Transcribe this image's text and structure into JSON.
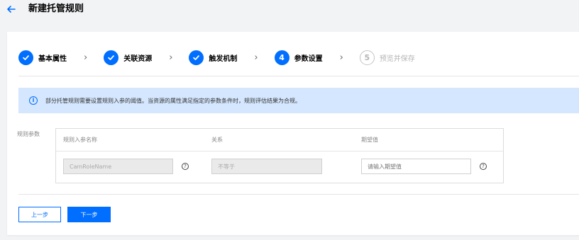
{
  "header": {
    "back_icon": "arrow-left-icon",
    "title": "新建托管规则"
  },
  "steps": [
    {
      "label": "基本属性",
      "state": "done",
      "icon": "check-icon"
    },
    {
      "label": "关联资源",
      "state": "done",
      "icon": "check-icon"
    },
    {
      "label": "触发机制",
      "state": "done",
      "icon": "check-icon"
    },
    {
      "label": "参数设置",
      "state": "active",
      "number": "4"
    },
    {
      "label": "预览并保存",
      "state": "pending",
      "number": "5"
    }
  ],
  "notice": {
    "icon": "info-icon",
    "text": "部分托管规则需要设置规则入参的阈值。当资源的属性满足指定的参数条件时，规则评估结果为合规。"
  },
  "params": {
    "section_label": "规则参数",
    "columns": [
      "规则入参名称",
      "关系",
      "期望值"
    ],
    "row": {
      "name_value": "CamRoleName",
      "relation_value": "不等于",
      "expected_placeholder": "请输入期望值"
    }
  },
  "footer": {
    "prev_label": "上一步",
    "next_label": "下一步"
  },
  "colors": {
    "primary": "#006eff",
    "notice_bg": "#d5e7ff"
  }
}
